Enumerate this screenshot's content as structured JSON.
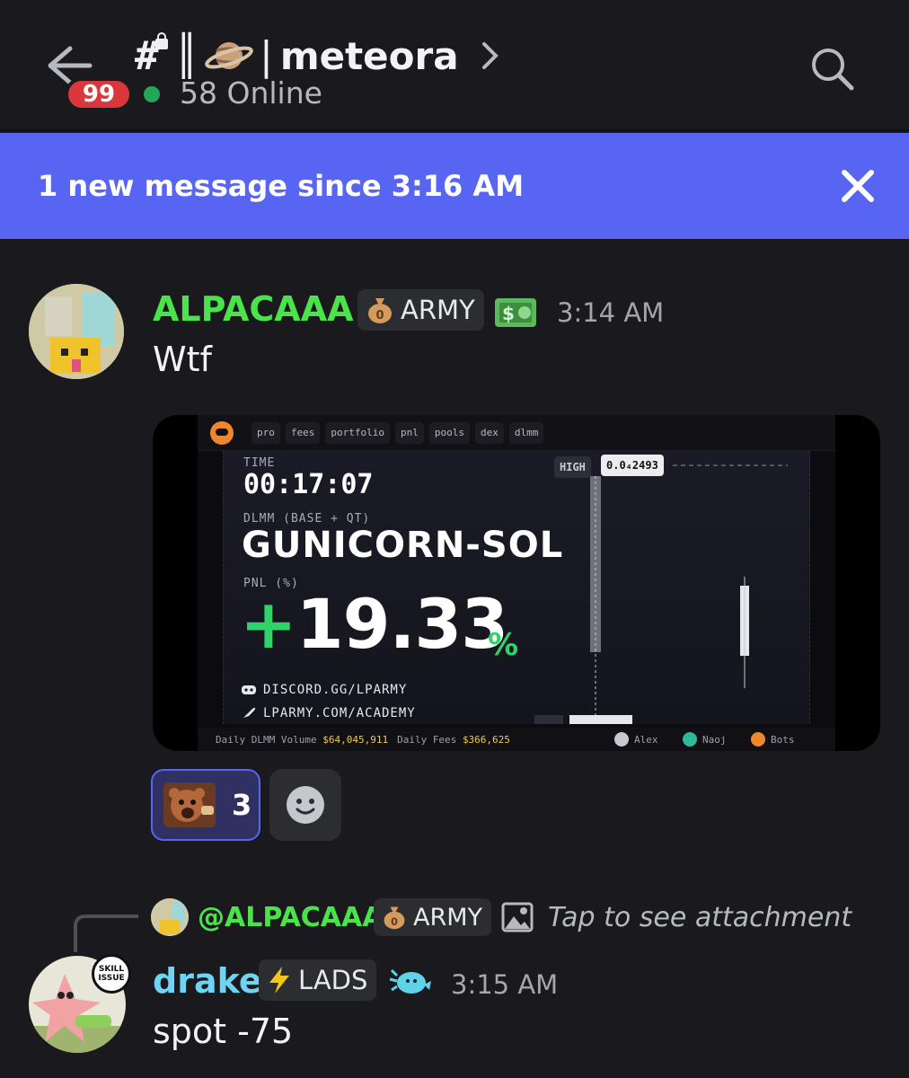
{
  "header": {
    "unread_count": "99",
    "channel_hash": "#",
    "channel_separator": "║",
    "channel_name": "meteora",
    "online_text": "58 Online"
  },
  "banner": {
    "text": "1 new message since 3:16 AM"
  },
  "messages": [
    {
      "author": "ALPACAAA",
      "author_color": "#4ae34a",
      "tag_label": "ARMY",
      "time": "3:14 AM",
      "text": "Wtf",
      "attachment": {
        "nav_items": [
          "pro",
          "fees",
          "portfolio",
          "pnl",
          "pools",
          "dex",
          "dlmm"
        ],
        "time_label": "TIME",
        "time_value": "00:17:07",
        "pair_label": "DLMM (BASE + QT)",
        "pair": "GUNICORN-SOL",
        "pnl_label": "PNL (%)",
        "pnl_sign": "+",
        "pnl_value": "19.33",
        "pnl_unit": "%",
        "links": [
          "DISCORD.GG/LPARMY",
          "LPARMY.COM/ACADEMY"
        ],
        "high_label": "HIGH",
        "high_value": "0.0₄2493",
        "footer": {
          "volume_label": "Daily DLMM Volume",
          "volume_value": "$64,045,911",
          "fees_label": "Daily Fees",
          "fees_value": "$366,625",
          "users": [
            "Alex",
            "Naoj",
            "Bots"
          ]
        }
      },
      "reaction_count": "3"
    },
    {
      "reply": {
        "mention": "@ALPACAAA",
        "tag_label": "ARMY",
        "text": "Tap to see attachment"
      },
      "author": "drake",
      "author_color": "#6fd3f3",
      "tag_label": "LADS",
      "time": "3:15 AM",
      "text": "spot -75",
      "avatar_badge": "SKILL ISSUE"
    }
  ],
  "colors": {
    "accent": "#5865f2",
    "background": "#1a1a1e",
    "online": "#23a55a",
    "badge": "#da373c",
    "pnl_green": "#2fd36a"
  }
}
